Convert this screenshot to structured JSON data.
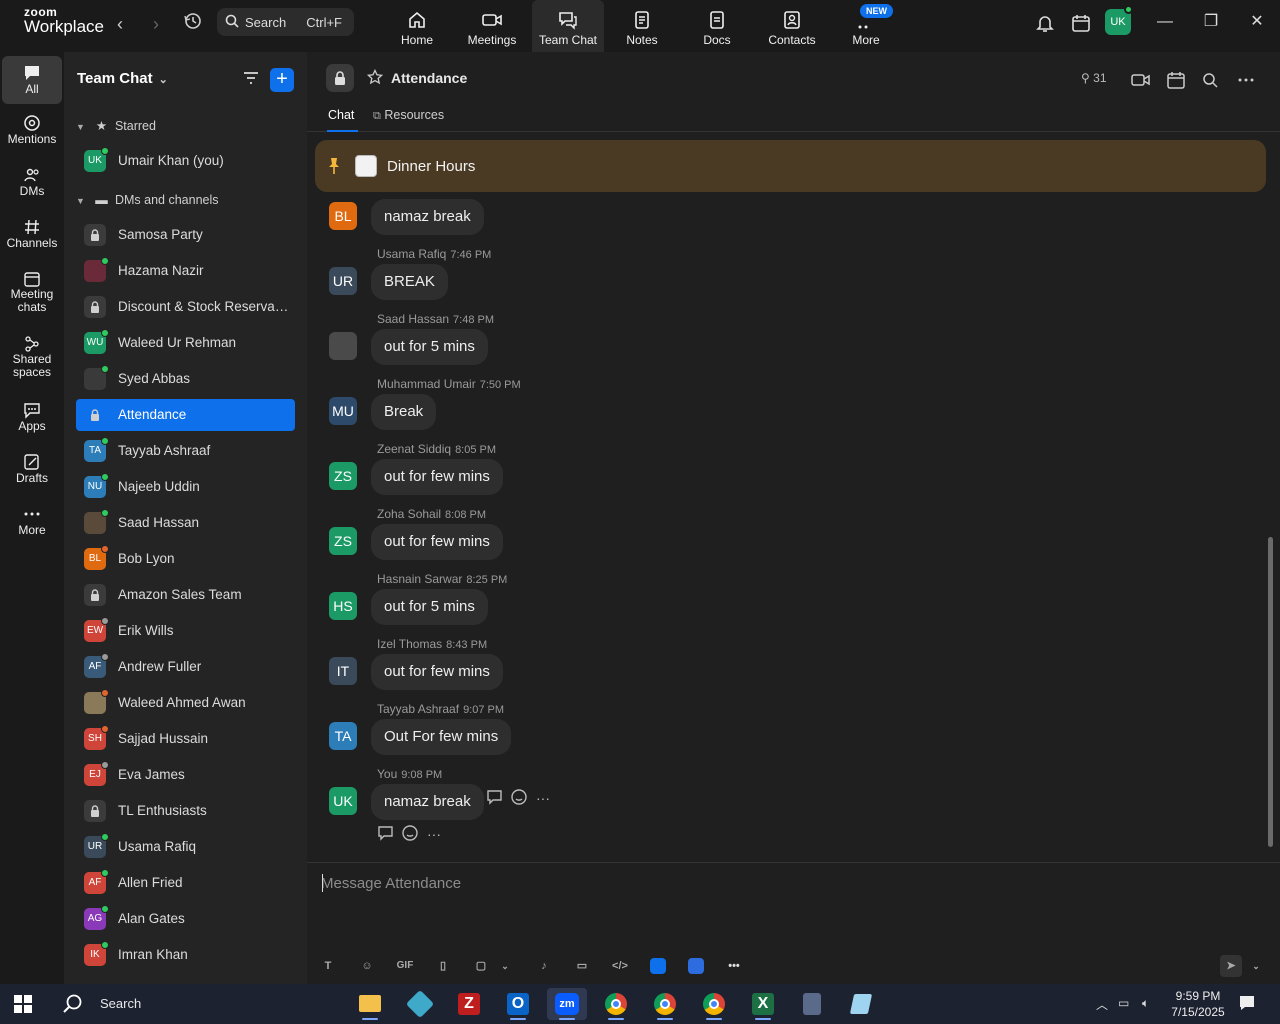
{
  "titlebar": {
    "brand_top": "zoom",
    "brand_bottom": "Workplace",
    "search_label": "Search",
    "search_shortcut": "Ctrl+F",
    "nav": [
      {
        "label": "Home",
        "icon": "home-icon"
      },
      {
        "label": "Meetings",
        "icon": "video-icon"
      },
      {
        "label": "Team Chat",
        "icon": "chat-icon"
      },
      {
        "label": "Notes",
        "icon": "notes-icon"
      },
      {
        "label": "Docs",
        "icon": "docs-icon"
      },
      {
        "label": "Contacts",
        "icon": "contacts-icon"
      },
      {
        "label": "More",
        "icon": "more-icon"
      }
    ],
    "new_badge": "NEW",
    "avatar": "UK",
    "colors": {
      "accent": "#0e71eb",
      "online": "#2ecc5f"
    }
  },
  "rail": [
    {
      "label": "All"
    },
    {
      "label": "Mentions"
    },
    {
      "label": "DMs"
    },
    {
      "label": "Channels"
    },
    {
      "label": "Meeting chats"
    },
    {
      "label": "Shared spaces"
    },
    {
      "label": "Apps"
    },
    {
      "label": "Drafts"
    },
    {
      "label": "More"
    }
  ],
  "sidebar": {
    "title": "Team Chat",
    "starred_label": "Starred",
    "dms_label": "DMs and channels",
    "starred": [
      {
        "name": "Umair Khan (you)",
        "initials": "UK",
        "color": "#1b9a66",
        "status": "#2ecc5f"
      }
    ],
    "items": [
      {
        "name": "Samosa Party",
        "initials": "",
        "type": "lock"
      },
      {
        "name": "Hazama Nazir",
        "initials": "",
        "color": "#6b2a3a",
        "status": "#2ecc5f"
      },
      {
        "name": "Discount & Stock Reservati...",
        "initials": "",
        "type": "lock"
      },
      {
        "name": "Waleed Ur Rehman",
        "initials": "WU",
        "color": "#1b9a66",
        "status": "#2ecc5f"
      },
      {
        "name": "Syed Abbas",
        "initials": "",
        "color": "#3a3a3a",
        "status": "#2ecc5f"
      },
      {
        "name": "Attendance",
        "initials": "",
        "type": "lock",
        "active": true
      },
      {
        "name": "Tayyab Ashraaf",
        "initials": "TA",
        "color": "#2d7db8",
        "status": "#2ecc5f"
      },
      {
        "name": "Najeeb Uddin",
        "initials": "NU",
        "color": "#2d7db8",
        "status": "#2ecc5f"
      },
      {
        "name": "Saad Hassan",
        "initials": "",
        "color": "#5a4a3a",
        "status": "#2ecc5f"
      },
      {
        "name": "Bob Lyon",
        "initials": "BL",
        "color": "#e06a10",
        "status": "#e0662e"
      },
      {
        "name": "Amazon Sales Team",
        "initials": "",
        "type": "lock"
      },
      {
        "name": "Erik Wills",
        "initials": "EW",
        "color": "#d0453a",
        "status": "#9a9a9a"
      },
      {
        "name": "Andrew Fuller",
        "initials": "AF",
        "color": "#3a5a7a",
        "status": "#9a9a9a"
      },
      {
        "name": "Waleed Ahmed Awan",
        "initials": "",
        "color": "#8a7a5a",
        "status": "#e0662e"
      },
      {
        "name": "Sajjad Hussain",
        "initials": "SH",
        "color": "#d0453a",
        "status": "#e0662e"
      },
      {
        "name": "Eva James",
        "initials": "EJ",
        "color": "#d0453a",
        "status": "#9a9a9a"
      },
      {
        "name": "TL Enthusiasts",
        "initials": "",
        "type": "lock"
      },
      {
        "name": "Usama Rafiq",
        "initials": "UR",
        "color": "#3a4a5a",
        "status": "#2ecc5f"
      },
      {
        "name": "Allen Fried",
        "initials": "AF",
        "color": "#d0453a",
        "status": "#2ecc5f"
      },
      {
        "name": "Alan Gates",
        "initials": "AG",
        "color": "#8a3ab8",
        "status": "#2ecc5f"
      },
      {
        "name": "Imran Khan",
        "initials": "IK",
        "color": "#d0453a",
        "status": "#2ecc5f"
      }
    ]
  },
  "channel": {
    "title": "Attendance",
    "members": "31",
    "tabs": [
      "Chat",
      "Resources"
    ],
    "pinned": "Dinner Hours"
  },
  "messages": [
    {
      "sender": "",
      "time": "",
      "initials": "BL",
      "color": "#e06a10",
      "text": "namaz break"
    },
    {
      "sender": "Usama Rafiq",
      "time": "7:46 PM",
      "initials": "UR",
      "color": "#3a4a5a",
      "text": "BREAK"
    },
    {
      "sender": "Saad Hassan",
      "time": "7:48 PM",
      "initials": "",
      "color": "#4a4a4a",
      "text": "out for 5 mins"
    },
    {
      "sender": "Muhammad Umair",
      "time": "7:50 PM",
      "initials": "MU",
      "color": "#2d4a6a",
      "text": "Break"
    },
    {
      "sender": "Zeenat Siddiq",
      "time": "8:05 PM",
      "initials": "ZS",
      "color": "#1b9a66",
      "text": "out for few mins"
    },
    {
      "sender": "Zoha Sohail",
      "time": "8:08 PM",
      "initials": "ZS",
      "color": "#1b9a66",
      "text": "out for few mins"
    },
    {
      "sender": "Hasnain Sarwar",
      "time": "8:25 PM",
      "initials": "HS",
      "color": "#1b9a66",
      "text": "out for 5 mins"
    },
    {
      "sender": "Izel Thomas",
      "time": "8:43 PM",
      "initials": "IT",
      "color": "#3a4a5a",
      "text": "out for few mins"
    },
    {
      "sender": "Tayyab Ashraaf",
      "time": "9:07 PM",
      "initials": "TA",
      "color": "#2d7db8",
      "text": "Out For few mins"
    },
    {
      "sender": "You",
      "time": "9:08 PM",
      "initials": "UK",
      "color": "#1b9a66",
      "text": "namaz break"
    }
  ],
  "composer": {
    "placeholder": "Message Attendance",
    "gif_label": "GIF"
  },
  "taskbar": {
    "search_label": "Search",
    "time": "9:59 PM",
    "date": "7/15/2025"
  }
}
